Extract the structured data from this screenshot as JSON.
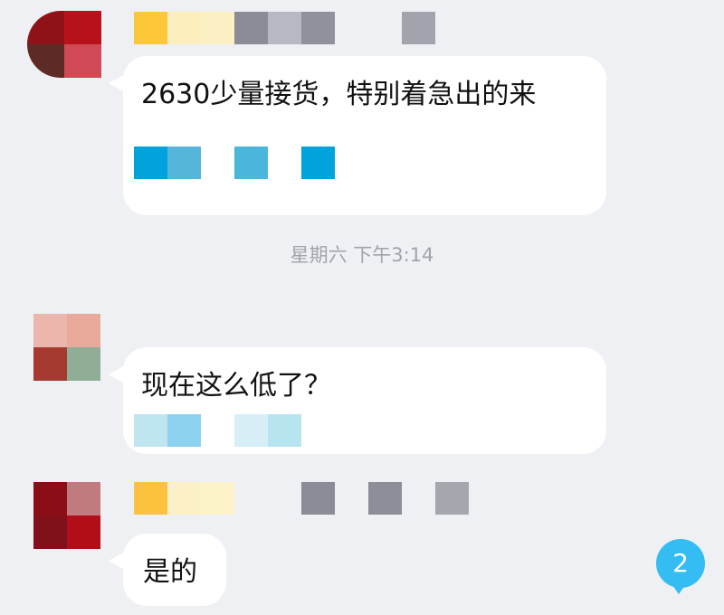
{
  "messages": [
    {
      "text": "2630少量接货，特别着急出的来"
    },
    {
      "text": "现在这么低了？"
    },
    {
      "text": "是的"
    }
  ],
  "timestamp": "星期六 下午3:14",
  "unread_badge": "2",
  "colors": {
    "background": "#eef0f4",
    "bubble": "#ffffff",
    "timestamp_text": "#a0a3aa",
    "badge": "#33bdf2"
  },
  "redacted": {
    "avatar_1": [
      "#8f1218",
      "#b7121b",
      "#5e2a25",
      "#cf4a54"
    ],
    "avatar_2": [
      "#ebb6ab",
      "#e9a99b",
      "#a43a30",
      "#8fae95"
    ],
    "avatar_3": [
      "#8b0d16",
      "#c07a80",
      "#80111b",
      "#b20e17"
    ],
    "name_1": [
      "#fcc83a",
      "#fdeebe",
      "#fbf0c3",
      "#8a8c98",
      "#b7b8c2",
      "#8f919c",
      "#eef0f4",
      "#eef0f4",
      "#a2a4ad"
    ],
    "name_2": [
      "#fbc13f",
      "#fcf0c6",
      "#fbf2c8",
      "#eef0f4",
      "#eef0f4",
      "#8a8c97",
      "#eef0f4",
      "#8c8e98",
      "#eef0f4",
      "#a5a7ae"
    ],
    "bubble_1": [
      "#00a2dc",
      "#55b5da",
      "#ffffff",
      "#4bb6dc",
      "#ffffff",
      "#00a3dc"
    ],
    "bubble_2": [
      "#bfe5f1",
      "#8dd3ef",
      "#ffffff",
      "#d6eff6",
      "#b6e4ef",
      "#ffffff"
    ]
  }
}
